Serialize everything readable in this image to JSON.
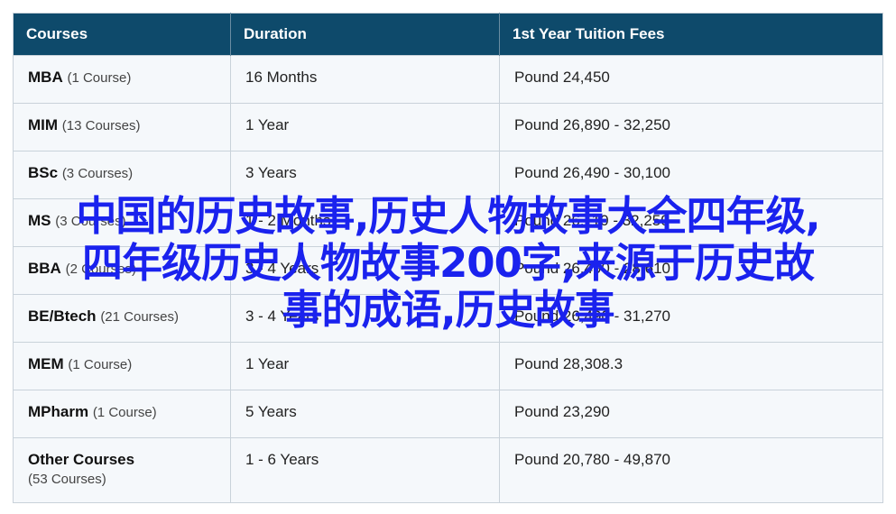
{
  "table": {
    "headers": [
      "Courses",
      "Duration",
      "1st Year Tuition Fees"
    ],
    "rows": [
      {
        "name": "MBA",
        "count": "(1 Course)",
        "duration": "16 Months",
        "fees": "Pound 24,450"
      },
      {
        "name": "MIM",
        "count": "(13 Courses)",
        "duration": "1 Year",
        "fees": "Pound 26,890 - 32,250"
      },
      {
        "name": "BSc",
        "count": "(3 Courses)",
        "duration": "3 Years",
        "fees": "Pound 26,490 - 30,100"
      },
      {
        "name": "MS",
        "count": "(3 Courses)",
        "duration": "1 - 2 Months",
        "fees": "Pound 26,110 - 32,250"
      },
      {
        "name": "BBA",
        "count": "(2 Courses)",
        "duration": "3 - 4 Years",
        "fees": "Pound 26,490 - 28,610"
      },
      {
        "name": "BE/Btech",
        "count": "(21 Courses)",
        "duration": "3 - 4 Years",
        "fees": "Pound 26,490 - 31,270"
      },
      {
        "name": "MEM",
        "count": "(1 Course)",
        "duration": "1 Year",
        "fees": "Pound 28,308.3"
      },
      {
        "name": "MPharm",
        "count": "(1 Course)",
        "duration": "5 Years",
        "fees": "Pound 23,290"
      },
      {
        "name": "Other Courses",
        "count": "(53 Courses)",
        "duration": "1 - 6 Years",
        "fees": "Pound 20,780 - 49,870"
      }
    ]
  },
  "overlay": {
    "line1": "中国的历史故事,历史人物故事大全四年级,",
    "line2": "四年级历史人物故事200字,来源于历史故",
    "line3": "事的成语,历史故事"
  },
  "colors": {
    "header_bg": "#0e4a6b",
    "cell_bg": "#f5f8fb",
    "overlay_text": "#1a22ee"
  }
}
